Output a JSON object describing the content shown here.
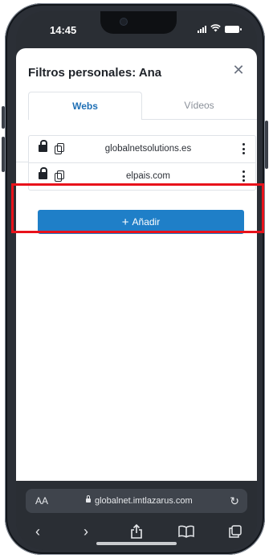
{
  "status_bar": {
    "time": "14:45"
  },
  "modal": {
    "title": "Filtros personales: Ana",
    "close_symbol": "✕"
  },
  "tabs": [
    {
      "label": "Webs",
      "active": true
    },
    {
      "label": "Vídeos",
      "active": false
    }
  ],
  "sites": [
    {
      "domain": "globalnetsolutions.es"
    },
    {
      "domain": "elpais.com"
    }
  ],
  "add_button": {
    "label": "Añadir",
    "icon": "+"
  },
  "safari": {
    "aa_label": "AA",
    "url": "globalnet.imtlazarus.com",
    "reload_symbol": "↻",
    "back_symbol": "‹",
    "forward_symbol": "›",
    "share_symbol": "⇧",
    "bookmarks_symbol": "📖",
    "tabs_symbol": "⧉"
  },
  "colors": {
    "accent": "#1f7fc8",
    "tab_active": "#1e6fb5",
    "highlight": "#e8121b"
  }
}
